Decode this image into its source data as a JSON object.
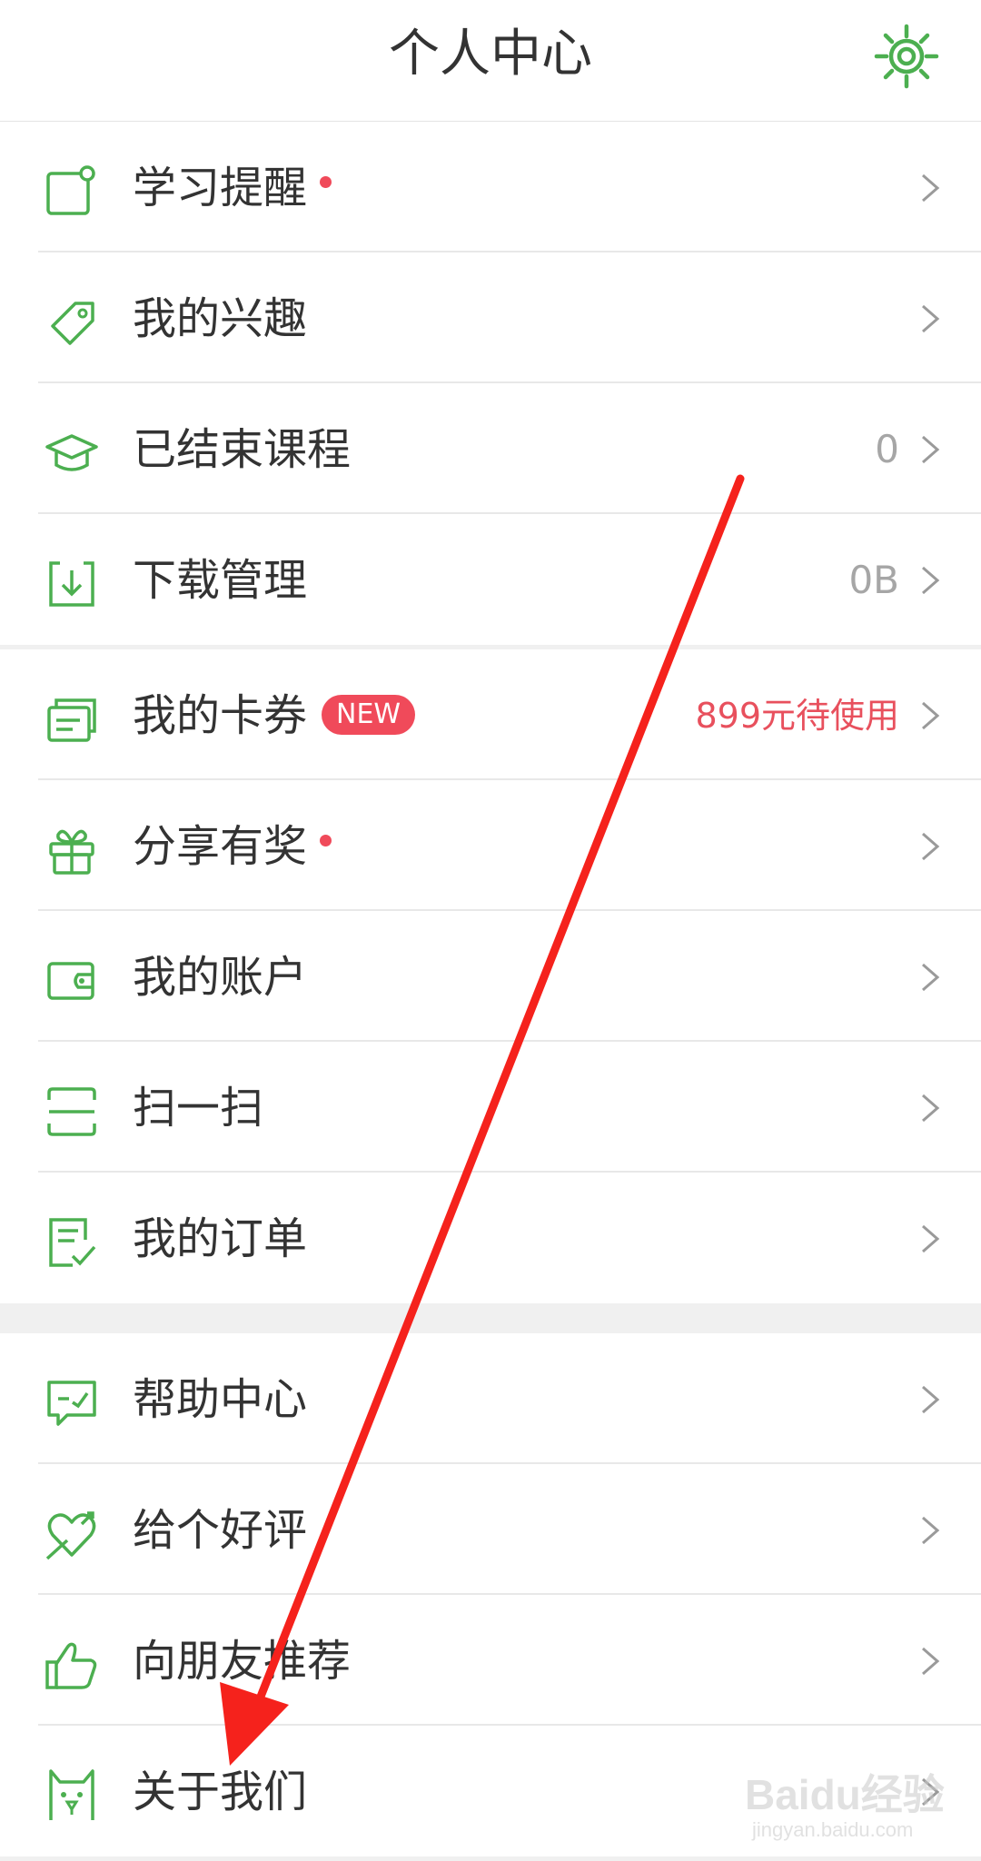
{
  "header": {
    "title": "个人中心",
    "settings_icon": "gear-icon"
  },
  "colors": {
    "brand_green": "#4caf50",
    "accent_red": "#f04a5a",
    "value_red": "#e8505d",
    "muted_text": "#a6a6a6",
    "annotation_arrow": "#f5221c"
  },
  "sections": [
    {
      "rows": [
        {
          "label": "学习提醒",
          "icon": "reminder-icon",
          "dot": true
        },
        {
          "label": "我的兴趣",
          "icon": "tag-icon"
        },
        {
          "label": "已结束课程",
          "icon": "graduation-cap-icon",
          "value": "0"
        },
        {
          "label": "下载管理",
          "icon": "download-icon",
          "value": "0B"
        }
      ]
    },
    {
      "rows": [
        {
          "label": "我的卡券",
          "icon": "coupon-icon",
          "badge": "NEW",
          "value": "899元待使用"
        },
        {
          "label": "分享有奖",
          "icon": "gift-icon",
          "dot": true
        },
        {
          "label": "我的账户",
          "icon": "wallet-icon"
        },
        {
          "label": "扫一扫",
          "icon": "scan-icon"
        },
        {
          "label": "我的订单",
          "icon": "order-icon"
        }
      ]
    },
    {
      "rows": [
        {
          "label": "帮助中心",
          "icon": "help-chat-icon"
        },
        {
          "label": "给个好评",
          "icon": "heart-icon"
        },
        {
          "label": "向朋友推荐",
          "icon": "thumbs-up-icon"
        },
        {
          "label": "关于我们",
          "icon": "mascot-icon"
        }
      ]
    }
  ],
  "watermark": {
    "brand": "Baidu经验",
    "url": "jingyan.baidu.com"
  }
}
